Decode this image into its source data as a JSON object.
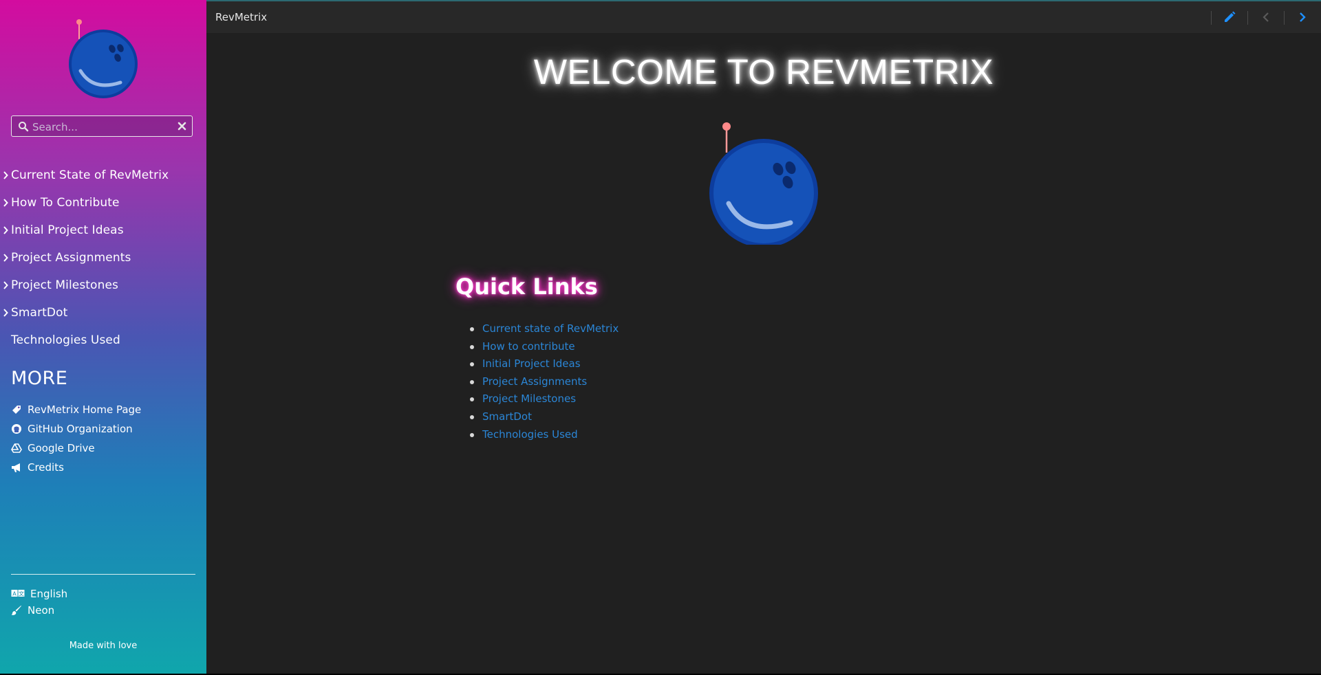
{
  "app": {
    "title": "RevMetrix"
  },
  "sidebar": {
    "search": {
      "placeholder": "Search...",
      "value": ""
    },
    "nav_items": [
      {
        "label": "Current State of RevMetrix",
        "has_children": true
      },
      {
        "label": "How To Contribute",
        "has_children": true
      },
      {
        "label": "Initial Project Ideas",
        "has_children": true
      },
      {
        "label": "Project Assignments",
        "has_children": true
      },
      {
        "label": "Project Milestones",
        "has_children": true
      },
      {
        "label": "SmartDot",
        "has_children": true
      },
      {
        "label": "Technologies Used",
        "has_children": false
      }
    ],
    "more_title": "MORE",
    "more_links": [
      {
        "label": "RevMetrix Home Page",
        "icon": "tag-icon"
      },
      {
        "label": "GitHub Organization",
        "icon": "github-icon"
      },
      {
        "label": "Google Drive",
        "icon": "google-drive-icon"
      },
      {
        "label": "Credits",
        "icon": "megaphone-icon"
      }
    ],
    "footer": {
      "language": "English",
      "theme": "Neon",
      "made_with": "Made with love"
    }
  },
  "topbar": {
    "icons": [
      "edit-icon",
      "chevron-left-icon",
      "chevron-right-icon"
    ]
  },
  "main": {
    "welcome_title": "WELCOME TO REVMETRIX",
    "quick_links_title": "Quick Links",
    "quick_links": [
      "Current state of RevMetrix",
      "How to contribute",
      "Initial Project Ideas",
      "Project Assignments",
      "Project Milestones",
      "SmartDot",
      "Technologies Used"
    ]
  },
  "colors": {
    "link": "#2b86d6",
    "accent_blue": "#1e90ff",
    "neon_pink": "#ff2bc8",
    "main_bg": "#202020",
    "topbar_bg": "#282828"
  }
}
